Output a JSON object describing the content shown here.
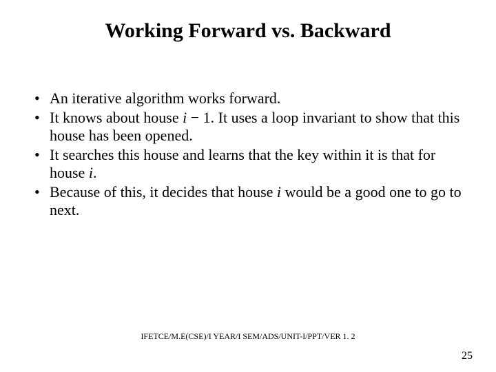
{
  "title": "Working Forward vs. Backward",
  "bullets": [
    {
      "pre": "An iterative algorithm works forward.",
      "var": "",
      "post": ""
    },
    {
      "pre": "It knows about house ",
      "var": "i",
      "post": " − 1. It uses a loop invariant to show that this house has been opened."
    },
    {
      "pre": "It searches this house and learns that the key within it is that for house ",
      "var": "i",
      "post": "."
    },
    {
      "pre": "Because of this, it decides that house ",
      "var": "i",
      "post": " would be a good one to go to next."
    }
  ],
  "footer": "IFETCE/M.E(CSE)/I YEAR/I SEM/ADS/UNIT-I/PPT/VER 1. 2",
  "page_number": "25"
}
